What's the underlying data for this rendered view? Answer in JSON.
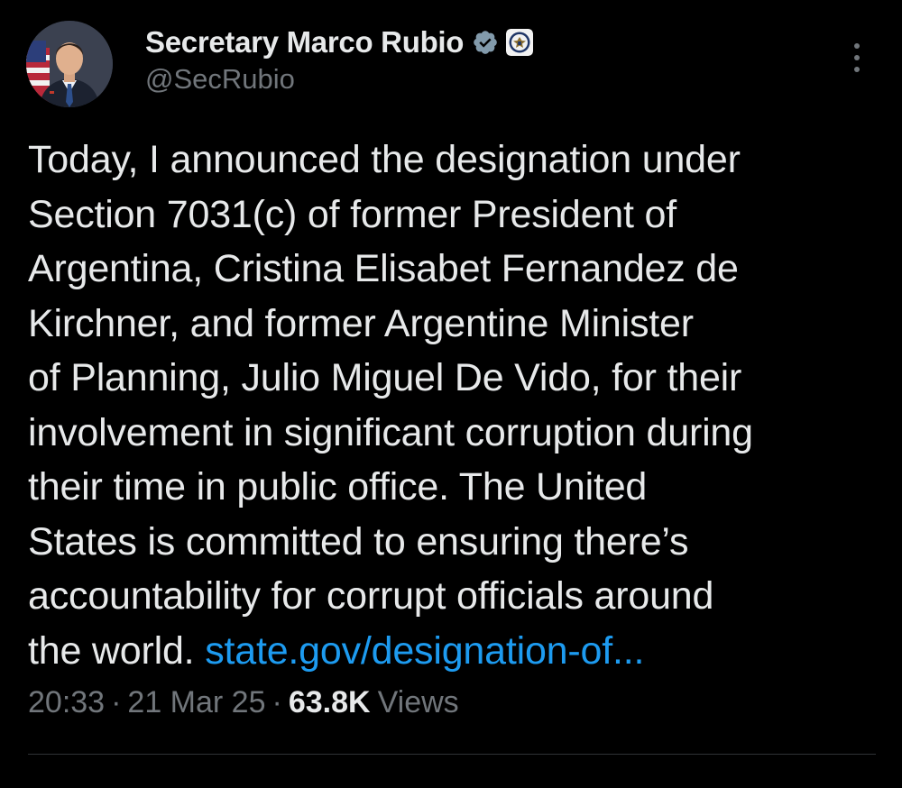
{
  "author": {
    "display_name": "Secretary Marco Rubio",
    "handle": "@SecRubio",
    "avatar_icon": "profile-photo",
    "verified_icon": "verified-badge-icon",
    "affiliate_icon": "state-department-seal-icon"
  },
  "tweet": {
    "lines": [
      "Today, I announced the designation under",
      "Section 7031(c) of former President of",
      "Argentina, Cristina Elisabet Fernandez de",
      "Kirchner, and former Argentine Minister",
      "of Planning, Julio Miguel De Vido, for their",
      "involvement in significant corruption during",
      "their time in public office. The United",
      "States is committed to ensuring there’s",
      "accountability for corrupt officials around"
    ],
    "last_line_text": "the world.",
    "link_text": "state.gov/designation-of..."
  },
  "meta": {
    "time": "20:33",
    "separator": "·",
    "date": "21 Mar 25",
    "views_count": "63.8K",
    "views_label": "Views"
  },
  "colors": {
    "background": "#000000",
    "text": "#e7e9ea",
    "secondary": "#71767b",
    "link": "#1d9bf0",
    "verified": "#829aab",
    "divider": "#2f3336"
  }
}
